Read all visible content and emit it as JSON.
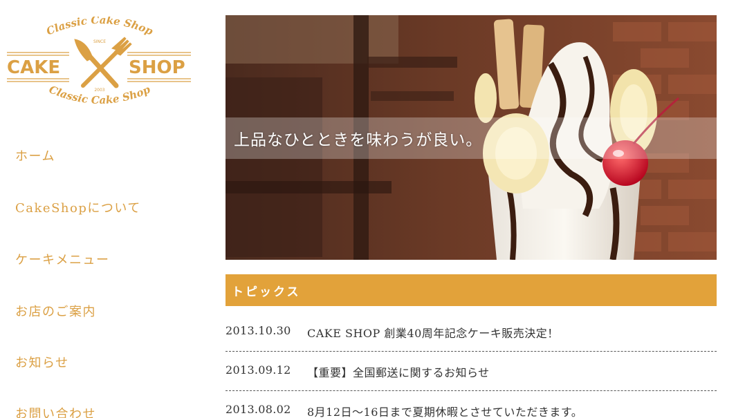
{
  "logo": {
    "arc_top": "Classic Cake Shop",
    "since": "SINCE",
    "word_left": "CAKE",
    "word_right": "SHOP",
    "year": "2003",
    "arc_bottom": "Classic Cake Shop",
    "icon": "crossed-fork-knife-icon",
    "color": "#dba044"
  },
  "nav": {
    "items": [
      {
        "label": "ホーム"
      },
      {
        "label": "CakeShopについて"
      },
      {
        "label": "ケーキメニュー"
      },
      {
        "label": "お店のご案内"
      },
      {
        "label": "お知らせ"
      },
      {
        "label": "お問い合わせ"
      }
    ]
  },
  "hero": {
    "caption": "上品なひとときを味わうが良い。"
  },
  "topics": {
    "heading": "トピックス",
    "items": [
      {
        "date": "2013.10.30",
        "title": "CAKE SHOP 創業40周年記念ケーキ販売決定！"
      },
      {
        "date": "2013.09.12",
        "title": "【重要】全国郵送に関するお知らせ"
      },
      {
        "date": "2013.08.02",
        "title": "8月12日～16日まで夏期休暇とさせていただきます。"
      }
    ]
  },
  "colors": {
    "accent": "#e2a23a",
    "nav_text": "#dba044",
    "body_text": "#333333"
  }
}
